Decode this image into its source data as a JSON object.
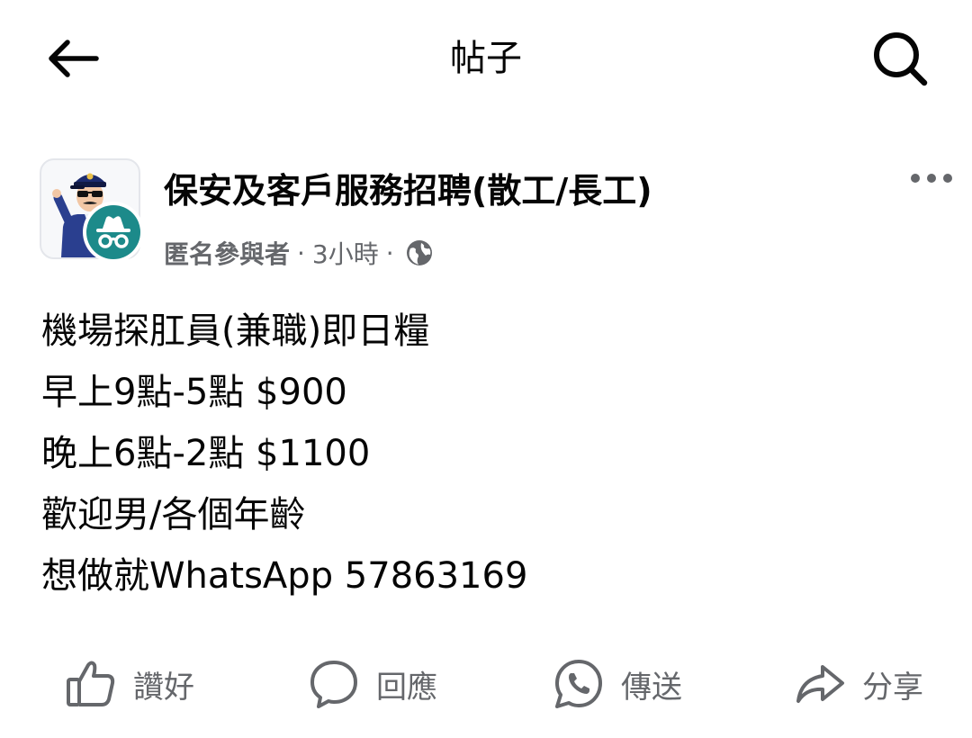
{
  "header": {
    "title": "帖子",
    "back_icon": "arrow-left-icon",
    "search_icon": "search-icon"
  },
  "post": {
    "group_name": "保安及客戶服務招聘(散工/長工)",
    "author": "匿名參與者",
    "separator": "·",
    "time": "3小時",
    "privacy_icon": "globe-icon",
    "more_icon": "more-horizontal-icon",
    "avatar_icon": "security-guard-avatar-icon",
    "badge_icon": "anonymous-incognito-icon",
    "lines": [
      "機場探肛員(兼職)即日糧",
      "早上9點-5點 $900",
      "晚上6點-2點 $1100",
      "歡迎男/各個年齡",
      "想做就WhatsApp 57863169"
    ]
  },
  "actions": {
    "like": {
      "label": "讚好",
      "icon": "thumbs-up-icon"
    },
    "comment": {
      "label": "回應",
      "icon": "comment-bubble-icon"
    },
    "send": {
      "label": "傳送",
      "icon": "whatsapp-icon"
    },
    "share": {
      "label": "分享",
      "icon": "share-arrow-icon"
    }
  },
  "colors": {
    "text": "#050505",
    "secondary": "#65676b",
    "badge": "#1c8a8a"
  }
}
